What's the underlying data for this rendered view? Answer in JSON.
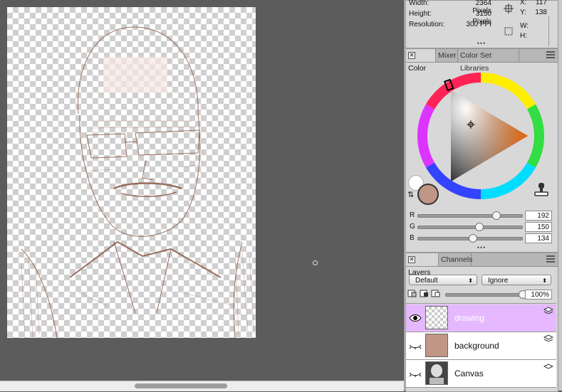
{
  "info": {
    "width_label": "Width:",
    "width_value": "2364 Pixels",
    "height_label": "Height:",
    "height_value": "3150 Pixels",
    "resolution_label": "Resolution:",
    "resolution_value": "300 PPI",
    "x_label": "X:",
    "x_value": "117",
    "y_label": "Y:",
    "y_value": "138",
    "w_label": "W:",
    "h_label": "H:"
  },
  "color_panel": {
    "tabs": [
      "Color",
      "Mixer",
      "Color Set Libraries"
    ],
    "r_label": "R",
    "g_label": "G",
    "b_label": "B",
    "r_value": "192",
    "g_value": "150",
    "b_value": "134",
    "r_fraction": 0.753,
    "g_fraction": 0.588,
    "b_fraction": 0.525,
    "main_color": "#c09686",
    "secondary_color": "#ffffff",
    "hue_indicator_color": "#ff6a00"
  },
  "layers_panel": {
    "tabs": [
      "Layers",
      "Channels"
    ],
    "composite_method": "Default",
    "composite_depth": "Ignore",
    "opacity_value": "100%",
    "opacity_fraction": 1.0,
    "layers": [
      {
        "name": "drawing",
        "selected": true,
        "visible": true
      },
      {
        "name": "background",
        "selected": false,
        "visible": false
      },
      {
        "name": "Canvas",
        "selected": false,
        "visible": false
      }
    ]
  },
  "icons": {
    "eye": "eye-icon",
    "eye_closed": "eye-closed-icon",
    "swap": "swap-colors-icon",
    "stamp": "clone-color-icon"
  }
}
